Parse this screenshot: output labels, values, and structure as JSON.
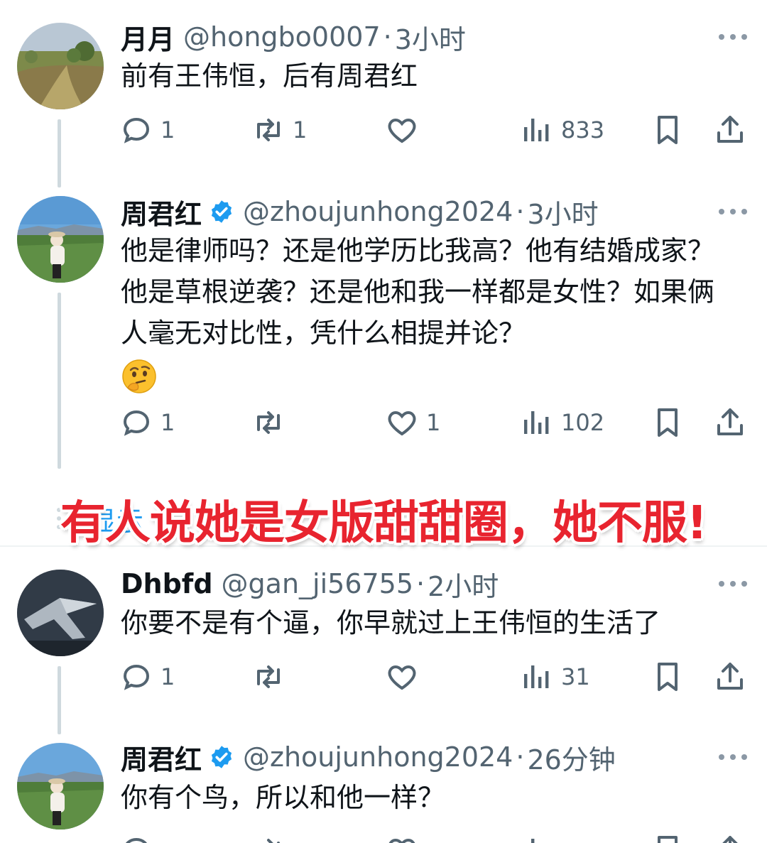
{
  "tweets": [
    {
      "name": "月月",
      "handle": "@hongbo0007",
      "dot": "·",
      "time": "3小时",
      "verified": false,
      "text": "前有王伟恒，后有周君红",
      "actions": {
        "reply": "1",
        "retweet": "1",
        "like": "",
        "views": "833"
      }
    },
    {
      "name": "周君红",
      "handle": "@zhoujunhong2024",
      "dot": "·",
      "time": "3小时",
      "verified": true,
      "text": "他是律师吗？还是他学历比我高？他有结婚成家？他是草根逆袭？还是他和我一样都是女性？如果俩人毫无对比性，凭什么相提并论？",
      "emoji": "thinking-face",
      "actions": {
        "reply": "1",
        "retweet": "",
        "like": "1",
        "views": "102"
      }
    },
    {
      "name": "Dhbfd",
      "handle": "@gan_ji56755",
      "dot": "·",
      "time": "2小时",
      "verified": false,
      "text": "你要不是有个逼，你早就过上王伟恒的生活了",
      "actions": {
        "reply": "1",
        "retweet": "",
        "like": "",
        "views": "31"
      }
    },
    {
      "name": "周君红",
      "handle": "@zhoujunhong2024",
      "dot": "·",
      "time": "26分钟",
      "verified": true,
      "text": "你有个鸟，所以和他一样？"
    }
  ],
  "show_more_label": "显示",
  "overlay_caption": "有人说她是女版甜甜圈，她不服!",
  "colors": {
    "verified": "#1d9bf0",
    "muted": "#536471",
    "caption": "#e8242f",
    "thread_line": "#cfd9de"
  },
  "icons": [
    "reply-icon",
    "retweet-icon",
    "like-icon",
    "views-icon",
    "bookmark-icon",
    "share-icon",
    "more-icon",
    "verified-badge-icon"
  ]
}
